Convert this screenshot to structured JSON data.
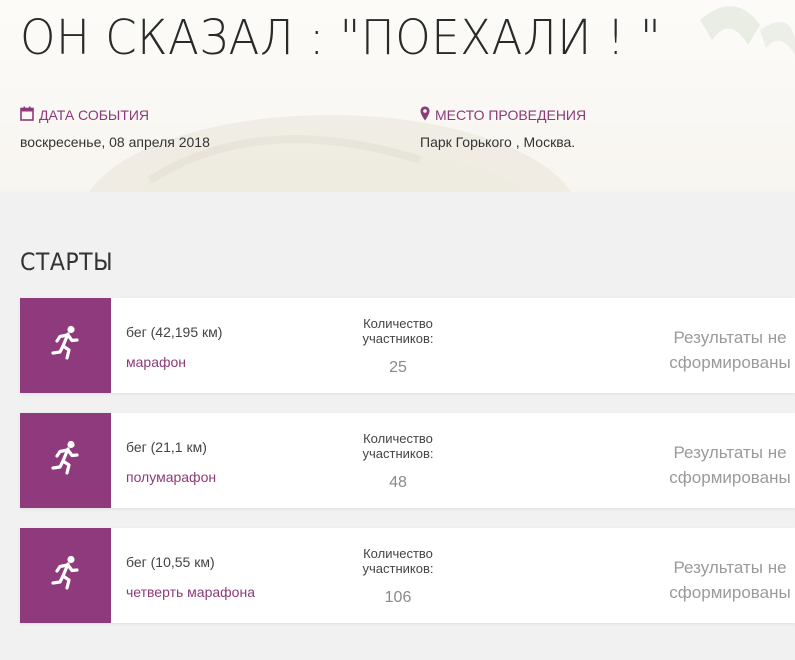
{
  "event": {
    "title": "ОН СКАЗАЛ : \"ПОЕХАЛИ ! \"",
    "date_label": "ДАТА СОБЫТИЯ",
    "date_value": "воскресенье, 08 апреля 2018",
    "place_label": "МЕСТО ПРОВЕДЕНИЯ",
    "place_value": "Парк Горького , Москва."
  },
  "starts": {
    "title": "СТАРТЫ",
    "count_label": "Количество участников:",
    "results_label": "Результаты не сформированы",
    "items": [
      {
        "distance": "бег (42,195 км)",
        "name": "марафон",
        "count": "25",
        "icon": "running-icon"
      },
      {
        "distance": "бег (21,1 км)",
        "name": "полумарафон",
        "count": "48",
        "icon": "running-icon"
      },
      {
        "distance": "бег (10,55 км)",
        "name": "четверть марафона",
        "count": "106",
        "icon": "running-icon"
      }
    ]
  },
  "colors": {
    "accent": "#8e3a7c",
    "accent_text": "#8c3a7a",
    "page_bg": "#f1f1f1",
    "card_bg": "#ffffff",
    "muted_text": "#9a9a9a"
  }
}
